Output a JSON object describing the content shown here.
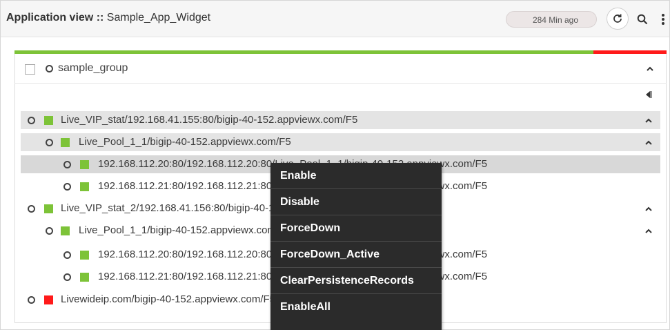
{
  "header": {
    "title_prefix": "Application view :: ",
    "app_name": "Sample_App_Widget",
    "last_updated": "284 Min ago"
  },
  "colors": {
    "status_up": "#7dc338",
    "status_down": "#ff1a1a"
  },
  "group": {
    "label": "sample_group"
  },
  "tree": [
    {
      "level": 0,
      "status": "up",
      "label": "Live_VIP_stat/192.168.41.155:80/bigip-40-152.appviewx.com/F5",
      "expanded": true
    },
    {
      "level": 1,
      "status": "up",
      "label": "Live_Pool_1_1/bigip-40-152.appviewx.com/F5",
      "expanded": true
    },
    {
      "level": 2,
      "status": "up",
      "label": "192.168.112.20:80/192.168.112.20:80/Live_Pool_1_1/bigip-40-152.appviewx.com/F5"
    },
    {
      "level": 2,
      "status": "up",
      "label": "192.168.112.21:80/192.168.112.21:80/Live_Pool_1_1/bigip-40-152.appviewx.com/F5"
    },
    {
      "level": 0,
      "status": "up",
      "label": "Live_VIP_stat_2/192.168.41.156:80/bigip-40-152.appviewx.com/F5",
      "expanded": true
    },
    {
      "level": 1,
      "status": "up",
      "label": "Live_Pool_1_1/bigip-40-152.appviewx.com/F5",
      "expanded": true
    },
    {
      "level": 2,
      "status": "up",
      "label": "192.168.112.20:80/192.168.112.20:80/Live_Pool_1_1/bigip-40-152.appviewx.com/F5"
    },
    {
      "level": 2,
      "status": "up",
      "label": "192.168.112.21:80/192.168.112.21:80/Live_Pool_1_1/bigip-40-152.appviewx.com/F5"
    },
    {
      "level": 0,
      "status": "down",
      "label": "Livewideip.com/bigip-40-152.appviewx.com/F5"
    }
  ],
  "context_menu": [
    "Enable",
    "Disable",
    "ForceDown",
    "ForceDown_Active",
    "ClearPersistenceRecords",
    "EnableAll"
  ]
}
